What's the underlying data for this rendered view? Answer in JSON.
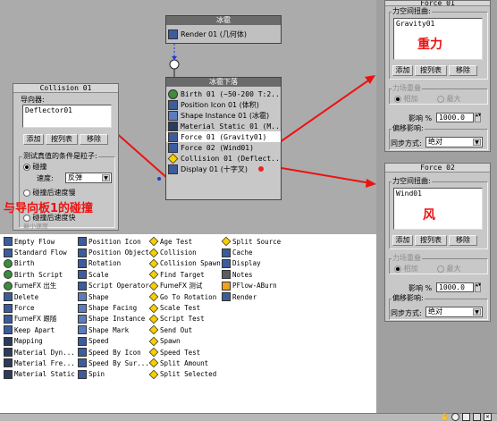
{
  "colors": {
    "annotation_red": "#ee1111",
    "graph_bg": "#ababab",
    "node_title": "#6b6b6b"
  },
  "render_event": {
    "title": "冰雹",
    "row": "Render 01 (几何体)"
  },
  "main_event": {
    "title": "冰雹下落",
    "rows": [
      "Birth 01 (~50-200 T:2...",
      "Position Icon 01 (体积)",
      "Shape Instance 01 (冰雹)",
      "Material Static 01 (M...",
      "Force 01 (Gravity01)",
      "Force 02 (Wind01)",
      "Collision 01 (Deflect...",
      "Display 01 (十字叉)"
    ]
  },
  "collision_panel": {
    "title": "Collision 01",
    "deflectors_label": "导向器:",
    "list_item": "Deflector01",
    "add": "添加",
    "by_list": "按列表",
    "remove": "移除",
    "test_group": "测试真值的条件是粒子:",
    "opt_collide": "碰撞",
    "speed_label": "速度:",
    "speed_value": "反弹",
    "opt_after_slow": "碰撞后速度慢",
    "opt_after_fast": "碰撞后速度快",
    "cut_text": "最小速度"
  },
  "force01_panel": {
    "title": "Force 01",
    "group_label": "力空间扭曲:",
    "list_item": "Gravity01",
    "add": "添加",
    "by_list": "按列表",
    "remove": "移除",
    "overlap_label": "力场重叠",
    "opt_add": "相加",
    "opt_max": "最大",
    "influence_label": "影响 %",
    "influence_value": "1000.0",
    "offset_label": "偏移影响:",
    "sync_label": "同步方式:",
    "sync_value": "绝对"
  },
  "force02_panel": {
    "title": "Force 02",
    "group_label": "力空间扭曲:",
    "list_item": "Wind01",
    "add": "添加",
    "by_list": "按列表",
    "remove": "移除",
    "overlap_label": "力场重叠",
    "opt_add": "相加",
    "opt_max": "最大",
    "influence_label": "影响 %",
    "influence_value": "1000.0",
    "offset_label": "偏移影响:",
    "sync_label": "同步方式:",
    "sync_value": "绝对"
  },
  "annotations": {
    "gravity": "重力",
    "wind": "风",
    "collision_note": "与导向板1的碰撞"
  },
  "depot": {
    "col1": [
      "Empty Flow",
      "Standard Flow",
      "Birth",
      "Birth Script",
      "FumeFX 出生",
      "Delete",
      "Force",
      "FumeFX 跟随",
      "Keep Apart",
      "Mapping",
      "Material Dyn...",
      "Material Fre...",
      "Material Static"
    ],
    "col2": [
      "Position Icon",
      "Position Object",
      "Rotation",
      "Scale",
      "Script Operator",
      "Shape",
      "Shape Facing",
      "Shape Instance",
      "Shape Mark",
      "Speed",
      "Speed By Icon",
      "Speed By Sur...",
      "Spin"
    ],
    "col3": [
      "Age Test",
      "Collision",
      "Collision Spawn",
      "Find Target",
      "FumeFX 测试",
      "Go To Rotation",
      "Scale Test",
      "Script Test",
      "Send Out",
      "Spawn",
      "Speed Test",
      "Split Amount",
      "Split Selected"
    ],
    "col4": [
      "Split Source",
      "Cache",
      "Display",
      "Notes",
      "PFlow-ABurn",
      "Render"
    ]
  },
  "status_icons": [
    "pan-hand-icon",
    "zoom-icon",
    "zoom-region-icon",
    "zoom-extents-icon",
    "close-icon"
  ]
}
